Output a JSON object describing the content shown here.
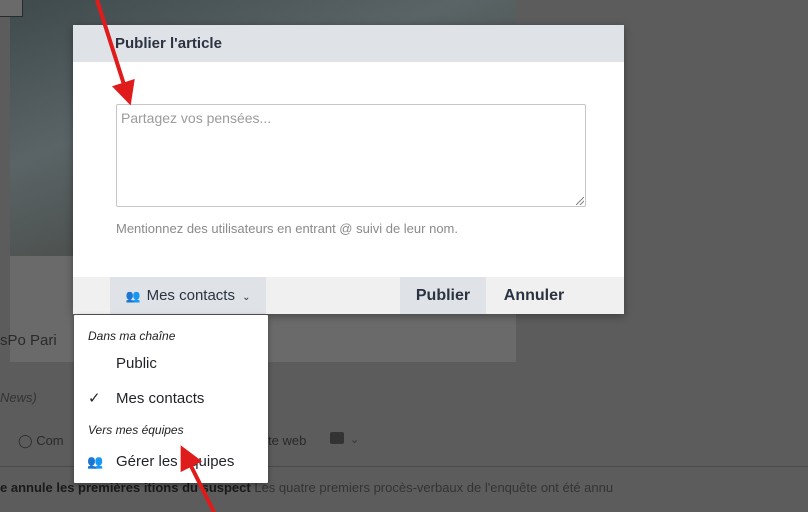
{
  "background": {
    "source_text": "sPo Pari",
    "news_text": "News)",
    "comment_text": "Com",
    "web_text": "te web",
    "headline_lead": "e annule les premières",
    "headline_mid": "itions du suspect",
    "headline_rest": "Les quatre premiers procès-verbaux de l'enquête ont été annu"
  },
  "modal": {
    "title": "Publier l'article",
    "textarea_placeholder": "Partagez vos pensées...",
    "help_text": "Mentionnez des utilisateurs en entrant @ suivi de leur nom.",
    "contacts_button_label": "Mes contacts",
    "publish_button_label": "Publier",
    "cancel_button_label": "Annuler"
  },
  "dropdown": {
    "section_channel": "Dans ma chaîne",
    "item_public": "Public",
    "item_contacts": "Mes contacts",
    "section_teams": "Vers mes équipes",
    "item_manage_teams": "Gérer les équipes"
  },
  "colors": {
    "overlay_bg": "#5c5c5c",
    "modal_header_bg": "#dfe3e8",
    "footer_bg": "#f0f0f0",
    "arrow": "#e01b1b"
  },
  "icons": {
    "contacts_icon": "users-icon",
    "check_icon": "check-icon",
    "teams_icon": "users-icon",
    "resize_icon": "resize-grip-icon"
  }
}
